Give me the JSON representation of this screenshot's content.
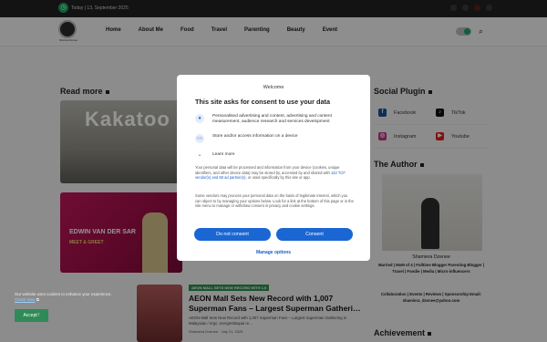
{
  "topbar": {
    "date": "Today | 13, September 2025"
  },
  "header": {
    "nav": [
      "Home",
      "About Me",
      "Food",
      "Travel",
      "Parenting",
      "Beauty",
      "Event"
    ],
    "logo_text": "Shamiera Dzenee"
  },
  "main": {
    "read_more_title": "Read more",
    "card1_image_text": "Kakatoo",
    "card2_image_title": "EDWIN VAN DER SAR",
    "card2_image_subtitle": "MEET & GREET",
    "article3": {
      "tag": "AEON MALL SETS NEW RECORD WITH 1,0",
      "title": "AEON Mall Sets New Record with 1,007 Superman Fans – Largest Superman Gatheri…",
      "excerpt": "AEON Mall Sets New Record with 1,007 Superman Fans – Largest Superman Gathering in Malaysian / ergo ,mergenttsupai re…",
      "meta": "Shamiera Dzenee  ·  July 21, 2025"
    }
  },
  "sidebar": {
    "social_title": "Social Plugin",
    "social": [
      {
        "label": "Facebook",
        "color": "#1b4f9c"
      },
      {
        "label": "TikTok",
        "color": "#111111"
      },
      {
        "label": "Instagram",
        "color": "#c13584"
      },
      {
        "label": "Youtube",
        "color": "#e02020"
      }
    ],
    "author_title": "The Author",
    "author_name": "Shamiera Dzenee",
    "author_bio": "Married | MoM of 4 | Fulltime Blogger Parenting Blogger | Travel | Foodie | Media | Micro-influencers",
    "author_extra": "Collaboration | Events | Reviews | Sponsorship Email: shamiera_dzenee@yahoo.com",
    "achievement_title": "Achievement"
  },
  "consent": {
    "welcome": "Welcome",
    "title": "This site asks for consent to use your data",
    "purposes": [
      {
        "icon": "person-icon",
        "text": "Personalised advertising and content, advertising and content measurement, audience research and services development"
      },
      {
        "icon": "device-icon",
        "text": "Store and/or access information on a device"
      }
    ],
    "learn_more": "Learn more",
    "body1_pre": "Your personal data will be processed and information from your device (cookies, unique identifiers, and other device data) may be stored by, accessed by and shared with ",
    "body1_link": "142 TCF vendor(s) and 68 ad partner(s)",
    "body1_post": ", or used specifically by this site or app.",
    "body2": "Some vendors may process your personal data on the basis of legitimate interest, which you can object to by managing your options below. Look for a link at the bottom of this page or in the site menu to manage or withdraw consent in privacy and cookie settings.",
    "do_not_consent": "Do not consent",
    "consent": "Consent",
    "manage_options": "Manage options"
  },
  "cookie": {
    "text": "Our website uses cookies to enhance your experience.",
    "link": "Check Now",
    "accept": "Accept !"
  }
}
